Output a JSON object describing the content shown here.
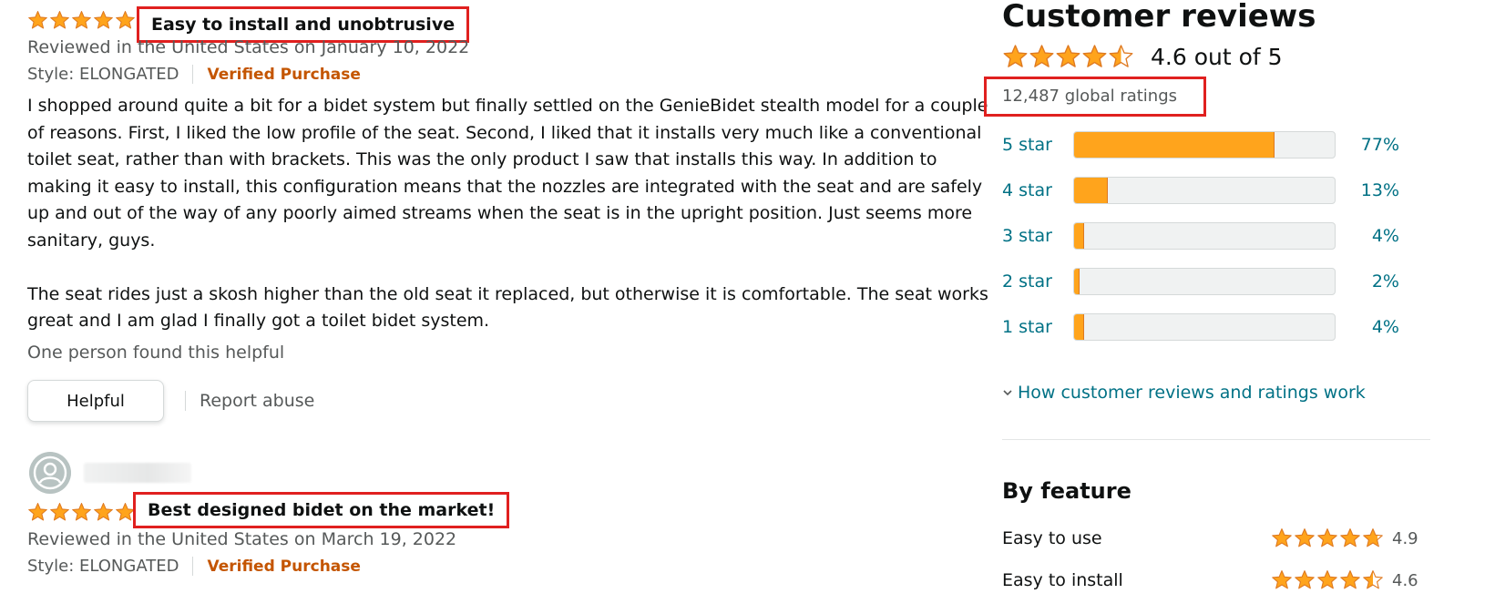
{
  "colors": {
    "star": "#ffa41c",
    "star_stroke": "#de7921",
    "link": "#007185",
    "verified": "#c45500",
    "highlight": "#e0201f"
  },
  "reviews": [
    {
      "rating": 5,
      "title": "Easy to install and unobtrusive",
      "meta": "Reviewed in the United States on January 10, 2022",
      "style": "Style: ELONGATED",
      "verified": "Verified Purchase",
      "body": [
        "I shopped around quite a bit for a bidet system but finally settled on the GenieBidet stealth model for a couple of reasons. First, I liked the low profile of the seat. Second, I liked that it installs very much like a conventional toilet seat, rather than with brackets. This was the only product I saw that installs this way. In addition to making it easy to install, this configuration means that the nozzles are integrated with the seat and are safely up and out of the way of any poorly aimed streams when the seat is in the upright position. Just seems more sanitary, guys.",
        "The seat rides just a skosh higher than the old seat it replaced, but otherwise it is comfortable. The seat works great and I am glad I finally got a toilet bidet system."
      ],
      "helpful_count": "One person found this helpful",
      "helpful_button": "Helpful",
      "report": "Report abuse"
    },
    {
      "rating": 5,
      "title": "Best designed bidet on the market!",
      "meta": "Reviewed in the United States on March 19, 2022",
      "style": "Style: ELONGATED",
      "verified": "Verified Purchase"
    }
  ],
  "summary": {
    "title": "Customer reviews",
    "rating": 4.6,
    "rating_text": "4.6 out of 5",
    "global_ratings": "12,487 global ratings",
    "histogram": [
      {
        "label": "5 star",
        "pct_text": "77%",
        "pct": 77
      },
      {
        "label": "4 star",
        "pct_text": "13%",
        "pct": 13
      },
      {
        "label": "3 star",
        "pct_text": "4%",
        "pct": 4
      },
      {
        "label": "2 star",
        "pct_text": "2%",
        "pct": 2
      },
      {
        "label": "1 star",
        "pct_text": "4%",
        "pct": 4
      }
    ],
    "how_link": "How customer reviews and ratings work"
  },
  "by_feature": {
    "title": "By feature",
    "items": [
      {
        "name": "Easy to use",
        "score": "4.9",
        "rating": 4.9
      },
      {
        "name": "Easy to install",
        "score": "4.6",
        "rating": 4.6
      }
    ]
  }
}
